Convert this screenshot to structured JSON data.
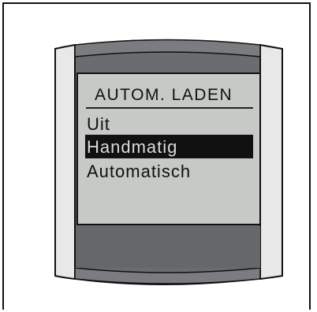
{
  "menu": {
    "title": "AUTOM. LADEN",
    "options": [
      {
        "label": "Uit",
        "selected": false
      },
      {
        "label": "Handmatig",
        "selected": true
      },
      {
        "label": "Automatisch",
        "selected": false
      }
    ]
  },
  "colors": {
    "screen_bg": "#c6c9c6",
    "device_dark": "#5e5e62",
    "device_mid": "#77787c",
    "side_panel": "#e6e6e6",
    "highlight": "#111111"
  }
}
